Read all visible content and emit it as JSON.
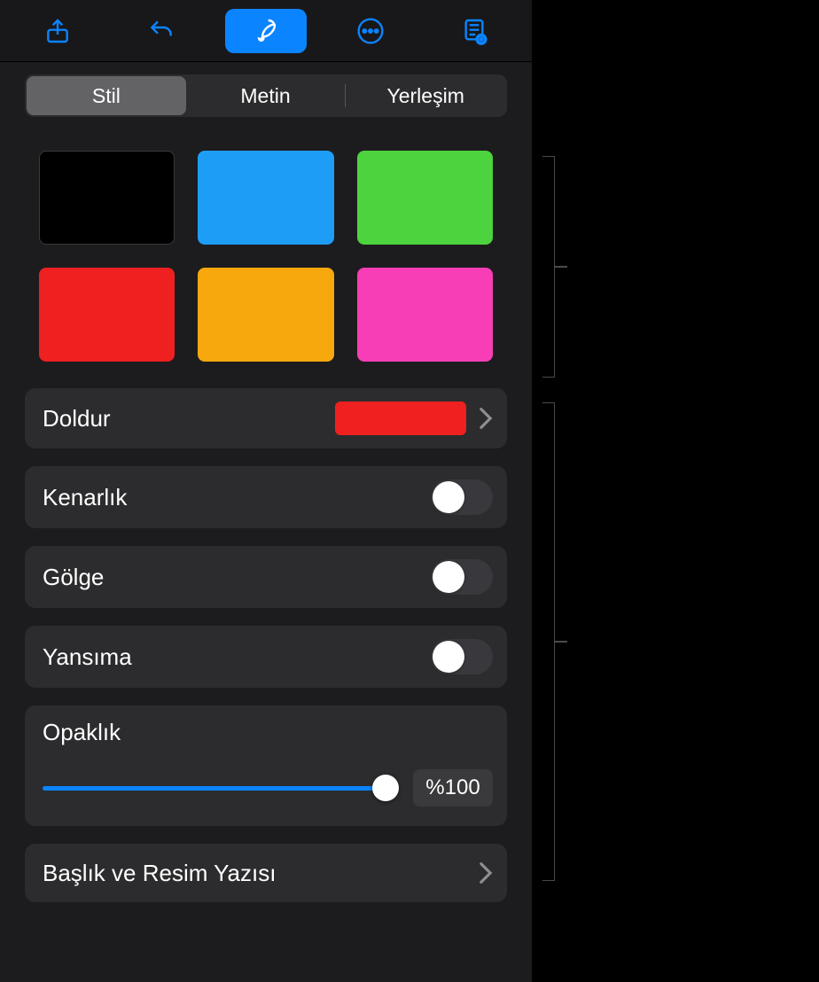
{
  "colors": {
    "accent": "#0a84ff",
    "panel": "#1c1c1e",
    "row": "#2c2c2e",
    "chevron": "#8e8e93"
  },
  "tabs": {
    "items": [
      {
        "label": "Stil",
        "selected": true
      },
      {
        "label": "Metin",
        "selected": false
      },
      {
        "label": "Yerleşim",
        "selected": false
      }
    ]
  },
  "swatches": [
    {
      "name": "black",
      "color": "#000000"
    },
    {
      "name": "blue",
      "color": "#1e9df7"
    },
    {
      "name": "green",
      "color": "#4cd33d"
    },
    {
      "name": "red",
      "color": "#ee2020"
    },
    {
      "name": "orange",
      "color": "#f7a80d"
    },
    {
      "name": "pink",
      "color": "#f73eb6"
    }
  ],
  "fill": {
    "label": "Doldur",
    "color": "#ee2020"
  },
  "toggles": {
    "border": {
      "label": "Kenarlık",
      "on": false
    },
    "shadow": {
      "label": "Gölge",
      "on": false
    },
    "reflection": {
      "label": "Yansıma",
      "on": false
    }
  },
  "opacity": {
    "label": "Opaklık",
    "value_text": "%100",
    "percent": 100
  },
  "title_caption": {
    "label": "Başlık ve Resim Yazısı"
  },
  "toolbar_icons": {
    "share": "share-icon",
    "undo": "undo-icon",
    "format": "brush-icon",
    "more": "more-icon",
    "document": "document-icon"
  }
}
